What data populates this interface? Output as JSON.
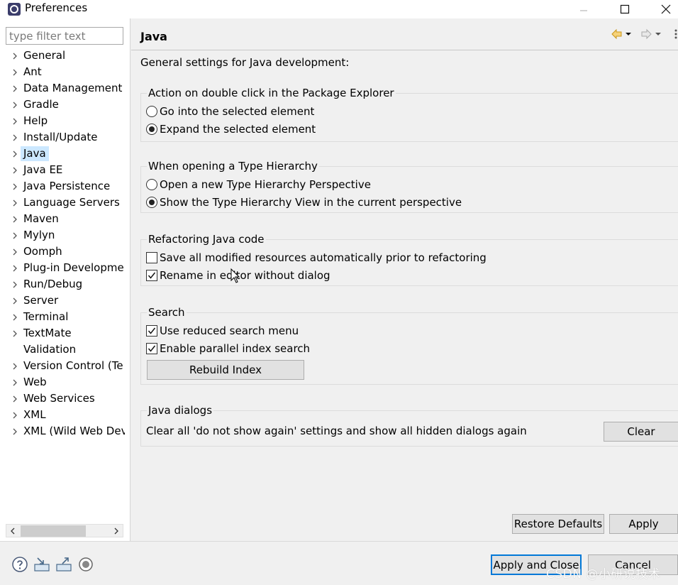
{
  "window": {
    "title": "Preferences"
  },
  "filter": {
    "placeholder": "type filter text"
  },
  "tree": {
    "items": [
      {
        "label": "General",
        "expandable": true
      },
      {
        "label": "Ant",
        "expandable": true
      },
      {
        "label": "Data Management",
        "expandable": true
      },
      {
        "label": "Gradle",
        "expandable": true
      },
      {
        "label": "Help",
        "expandable": true
      },
      {
        "label": "Install/Update",
        "expandable": true
      },
      {
        "label": "Java",
        "expandable": true,
        "selected": true
      },
      {
        "label": "Java EE",
        "expandable": true
      },
      {
        "label": "Java Persistence",
        "expandable": true
      },
      {
        "label": "Language Servers",
        "expandable": true
      },
      {
        "label": "Maven",
        "expandable": true
      },
      {
        "label": "Mylyn",
        "expandable": true
      },
      {
        "label": "Oomph",
        "expandable": true
      },
      {
        "label": "Plug-in Developme",
        "expandable": true
      },
      {
        "label": "Run/Debug",
        "expandable": true
      },
      {
        "label": "Server",
        "expandable": true
      },
      {
        "label": "Terminal",
        "expandable": true
      },
      {
        "label": "TextMate",
        "expandable": true
      },
      {
        "label": "Validation",
        "expandable": false
      },
      {
        "label": "Version Control (Te",
        "expandable": true
      },
      {
        "label": "Web",
        "expandable": true
      },
      {
        "label": "Web Services",
        "expandable": true
      },
      {
        "label": "XML",
        "expandable": true
      },
      {
        "label": "XML (Wild Web Dev",
        "expandable": true
      }
    ]
  },
  "page": {
    "title": "Java",
    "intro": "General settings for Java development:",
    "groups": {
      "double_click": {
        "title": "Action on double click in the Package Explorer",
        "options": [
          {
            "label": "Go into the selected element",
            "selected": false
          },
          {
            "label": "Expand the selected element",
            "selected": true
          }
        ]
      },
      "type_hierarchy": {
        "title": "When opening a Type Hierarchy",
        "options": [
          {
            "label": "Open a new Type Hierarchy Perspective",
            "selected": false
          },
          {
            "label": "Show the Type Hierarchy View in the current perspective",
            "selected": true
          }
        ]
      },
      "refactoring": {
        "title": "Refactoring Java code",
        "options": [
          {
            "label": "Save all modified resources automatically prior to refactoring",
            "checked": false
          },
          {
            "label": "Rename in editor without dialog",
            "checked": true
          }
        ]
      },
      "search": {
        "title": "Search",
        "options": [
          {
            "label": "Use reduced search menu",
            "checked": true
          },
          {
            "label": "Enable parallel index search",
            "checked": true
          }
        ],
        "rebuild_label": "Rebuild Index"
      },
      "dialogs": {
        "title": "Java dialogs",
        "text": "Clear all 'do not show again' settings and show all hidden dialogs again",
        "clear_label": "Clear"
      }
    },
    "restore_label": "Restore Defaults",
    "apply_label": "Apply"
  },
  "footer": {
    "apply_close_label": "Apply and Close",
    "cancel_label": "Cancel",
    "watermark": "CSDN @小研说技术"
  },
  "icons": {
    "footer": [
      "help-icon",
      "import-icon",
      "export-icon",
      "record-icon"
    ],
    "header": [
      "back-arrow-icon",
      "back-menu-icon",
      "forward-arrow-icon",
      "forward-menu-icon",
      "view-menu-icon"
    ]
  },
  "colors": {
    "selection": "#cce8ff",
    "default_button_border": "#0078d7",
    "back_arrow": "#e0a020"
  }
}
